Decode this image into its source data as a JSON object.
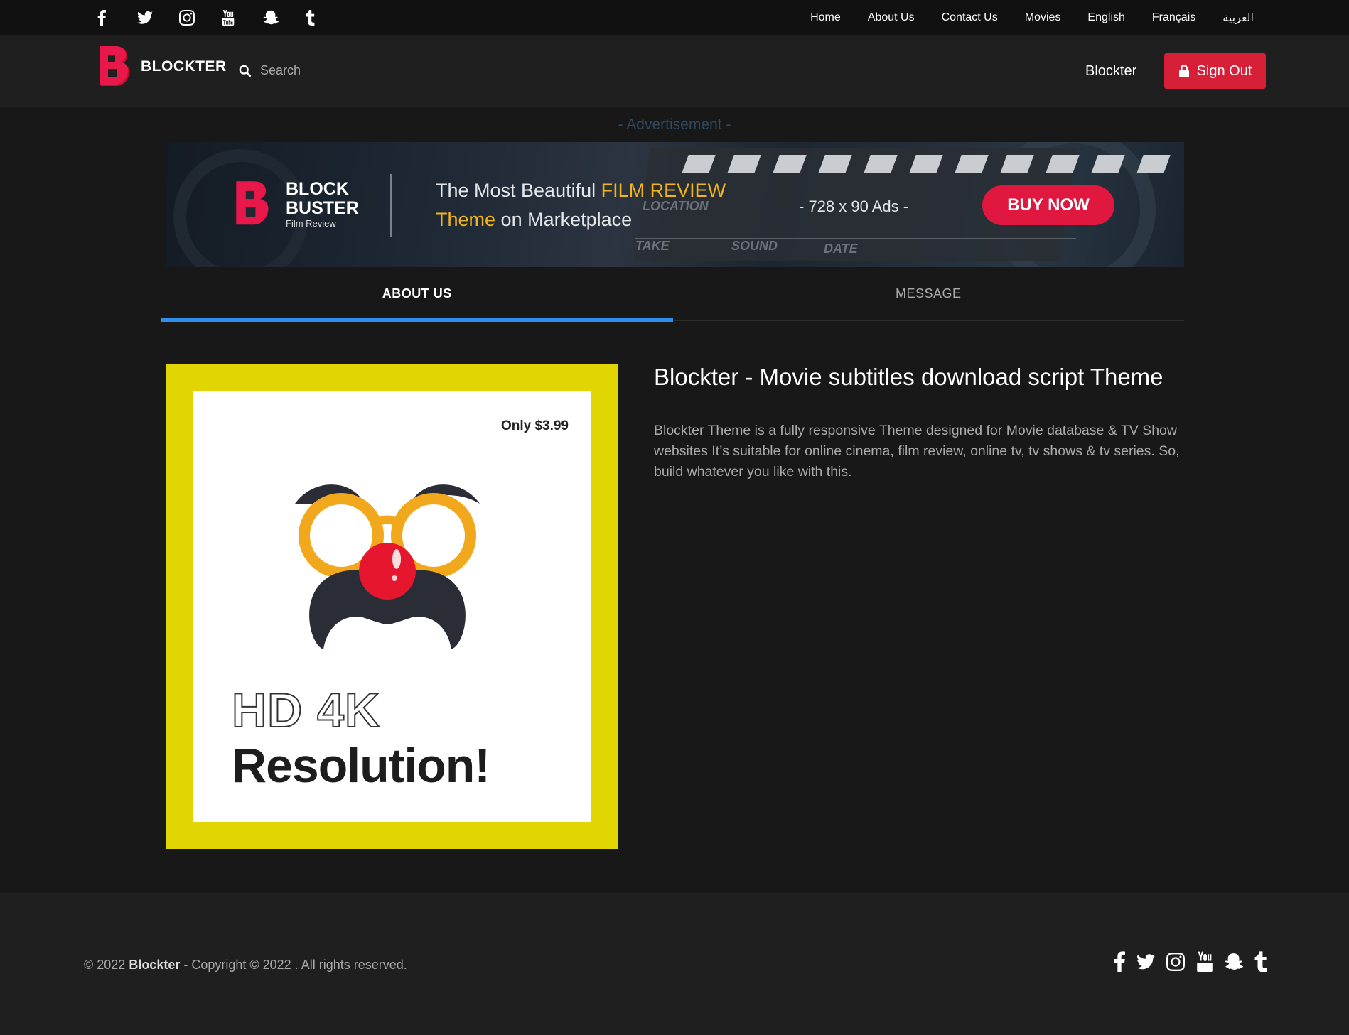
{
  "topbar": {
    "socials": [
      "facebook-icon",
      "twitter-icon",
      "instagram-icon",
      "youtube-icon",
      "snapchat-icon",
      "tumblr-icon"
    ],
    "nav": [
      "Home",
      "About Us",
      "Contact Us",
      "Movies",
      "English",
      "Français",
      "العربية"
    ]
  },
  "header": {
    "logo_text": "BLOCKTER",
    "search_placeholder": "Search",
    "username": "Blockter",
    "signout_label": "Sign Out"
  },
  "ad": {
    "label": "- Advertisement -",
    "brand_line1": "BLOCK",
    "brand_line2": "BUSTER",
    "brand_sub": "Film Review",
    "headline_part1": "The Most Beautiful ",
    "headline_highlight1": "FILM REVIEW",
    "headline_highlight2": "Theme",
    "headline_part2": " on Marketplace",
    "size_text": "- 728 x 90 Ads -",
    "cta": "BUY NOW",
    "clapper_words": [
      "LOCATION",
      "TAKE",
      "SOUND",
      "DATE"
    ]
  },
  "tabs": [
    {
      "label": "ABOUT US",
      "active": true
    },
    {
      "label": "MESSAGE",
      "active": false
    }
  ],
  "promo": {
    "price": "Only $3.99",
    "line1": "HD 4K",
    "line2": "Resolution!"
  },
  "about": {
    "title": "Blockter - Movie subtitles download script Theme",
    "description": "Blockter Theme is a fully responsive Theme designed for Movie database & TV Show websites It’s suitable for online cinema, film review, online tv, tv shows & tv series. So, build whatever you like with this."
  },
  "footer": {
    "copy_prefix": "© 2022 ",
    "copy_brand": "Blockter",
    "copy_suffix": " - Copyright © 2022 . All rights reserved.",
    "socials": [
      "facebook-icon",
      "twitter-icon",
      "instagram-icon",
      "youtube-icon",
      "snapchat-icon",
      "tumblr-icon"
    ]
  },
  "colors": {
    "accent_red": "#d81f38",
    "tab_active": "#2f8ef0",
    "promo_yellow": "#e2d504",
    "ad_highlight": "#f2b51b"
  }
}
